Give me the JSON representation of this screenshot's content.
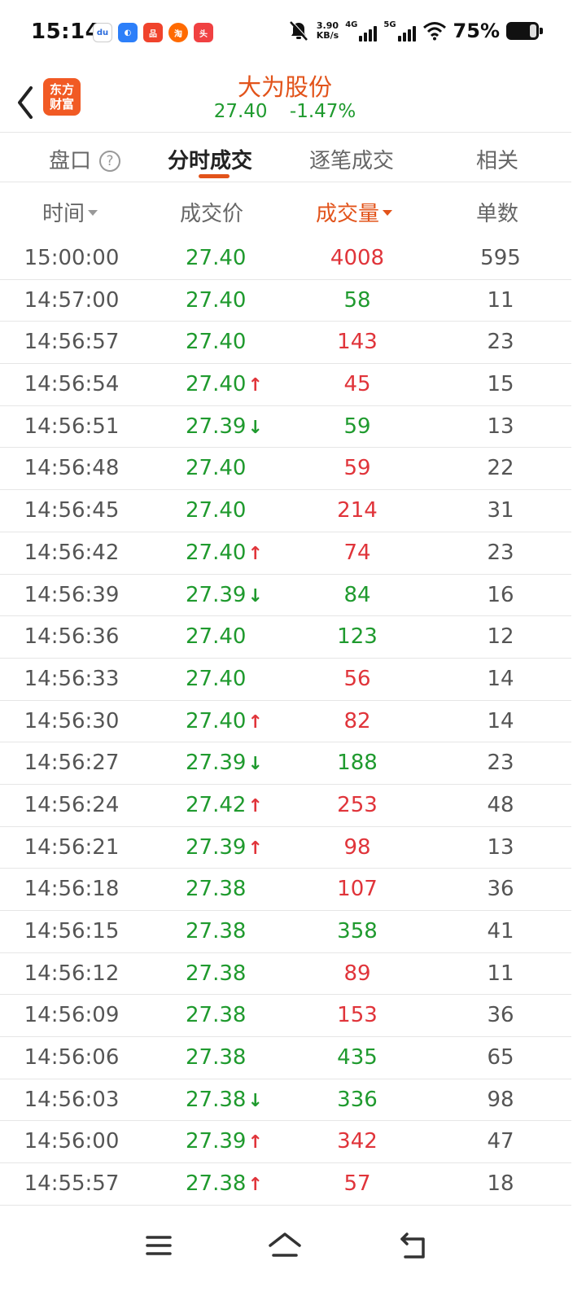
{
  "status_bar": {
    "time": "15:14",
    "app_icons": [
      "baidu-app-icon",
      "browser-app-icon",
      "pinduoduo-app-icon",
      "taobao-app-icon",
      "toutiao-app-icon"
    ],
    "net_speed_value": "3.90",
    "net_speed_unit": "KB/s",
    "network_4g": "4G",
    "network_5g": "5G",
    "battery": "75%"
  },
  "header": {
    "logo_line1": "东方",
    "logo_line2": "财富",
    "stock_name": "大为股份",
    "price": "27.40",
    "change": "-1.47%"
  },
  "tabs": {
    "pankou": "盘口",
    "help": "?",
    "fenshi": "分时成交",
    "zhubi": "逐笔成交",
    "xiangguan": "相关"
  },
  "columns": {
    "time": "时间",
    "price": "成交价",
    "volume": "成交量",
    "count": "单数"
  },
  "colors": {
    "accent": "#e2531a",
    "up": "#e0343a",
    "down": "#1f9a2e"
  },
  "trades": [
    {
      "time": "15:00:00",
      "price": "27.40",
      "arrow": "",
      "volume": "4008",
      "dir": "red",
      "count": "595"
    },
    {
      "time": "14:57:00",
      "price": "27.40",
      "arrow": "",
      "volume": "58",
      "dir": "green",
      "count": "11"
    },
    {
      "time": "14:56:57",
      "price": "27.40",
      "arrow": "",
      "volume": "143",
      "dir": "red",
      "count": "23"
    },
    {
      "time": "14:56:54",
      "price": "27.40",
      "arrow": "↑",
      "volume": "45",
      "dir": "red",
      "count": "15"
    },
    {
      "time": "14:56:51",
      "price": "27.39",
      "arrow": "↓",
      "volume": "59",
      "dir": "green",
      "count": "13"
    },
    {
      "time": "14:56:48",
      "price": "27.40",
      "arrow": "",
      "volume": "59",
      "dir": "red",
      "count": "22"
    },
    {
      "time": "14:56:45",
      "price": "27.40",
      "arrow": "",
      "volume": "214",
      "dir": "red",
      "count": "31"
    },
    {
      "time": "14:56:42",
      "price": "27.40",
      "arrow": "↑",
      "volume": "74",
      "dir": "red",
      "count": "23"
    },
    {
      "time": "14:56:39",
      "price": "27.39",
      "arrow": "↓",
      "volume": "84",
      "dir": "green",
      "count": "16"
    },
    {
      "time": "14:56:36",
      "price": "27.40",
      "arrow": "",
      "volume": "123",
      "dir": "green",
      "count": "12"
    },
    {
      "time": "14:56:33",
      "price": "27.40",
      "arrow": "",
      "volume": "56",
      "dir": "red",
      "count": "14"
    },
    {
      "time": "14:56:30",
      "price": "27.40",
      "arrow": "↑",
      "volume": "82",
      "dir": "red",
      "count": "14"
    },
    {
      "time": "14:56:27",
      "price": "27.39",
      "arrow": "↓",
      "volume": "188",
      "dir": "green",
      "count": "23"
    },
    {
      "time": "14:56:24",
      "price": "27.42",
      "arrow": "↑",
      "volume": "253",
      "dir": "red",
      "count": "48"
    },
    {
      "time": "14:56:21",
      "price": "27.39",
      "arrow": "↑",
      "volume": "98",
      "dir": "red",
      "count": "13"
    },
    {
      "time": "14:56:18",
      "price": "27.38",
      "arrow": "",
      "volume": "107",
      "dir": "red",
      "count": "36"
    },
    {
      "time": "14:56:15",
      "price": "27.38",
      "arrow": "",
      "volume": "358",
      "dir": "green",
      "count": "41"
    },
    {
      "time": "14:56:12",
      "price": "27.38",
      "arrow": "",
      "volume": "89",
      "dir": "red",
      "count": "11"
    },
    {
      "time": "14:56:09",
      "price": "27.38",
      "arrow": "",
      "volume": "153",
      "dir": "red",
      "count": "36"
    },
    {
      "time": "14:56:06",
      "price": "27.38",
      "arrow": "",
      "volume": "435",
      "dir": "green",
      "count": "65"
    },
    {
      "time": "14:56:03",
      "price": "27.38",
      "arrow": "↓",
      "volume": "336",
      "dir": "green",
      "count": "98"
    },
    {
      "time": "14:56:00",
      "price": "27.39",
      "arrow": "↑",
      "volume": "342",
      "dir": "red",
      "count": "47"
    },
    {
      "time": "14:55:57",
      "price": "27.38",
      "arrow": "↑",
      "volume": "57",
      "dir": "red",
      "count": "18"
    }
  ],
  "nav_bar": {
    "menu": "menu-icon",
    "home": "home-icon",
    "back": "back-icon"
  }
}
